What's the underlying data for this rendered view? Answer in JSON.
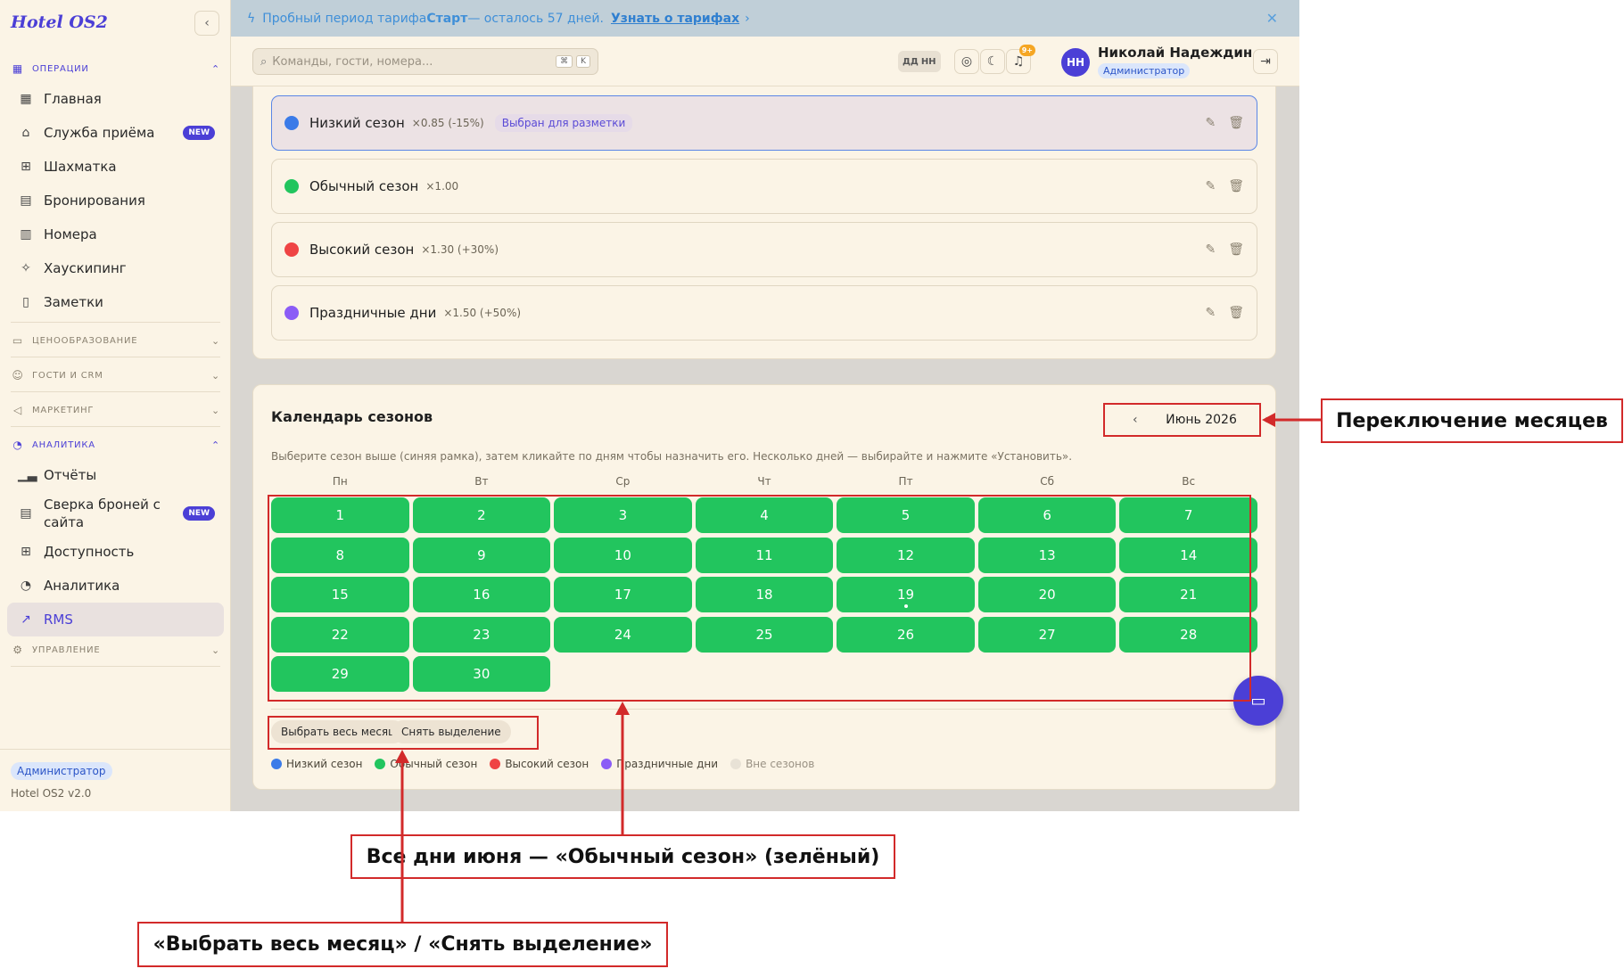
{
  "app": {
    "brand": "Hotel OS2"
  },
  "banner": {
    "text_prefix": "Пробный период тарифа ",
    "plan": "Старт",
    "text_suffix": " — осталось 57 дней.",
    "link": "Узнать о тарифах",
    "arrow": "›",
    "close": "✕"
  },
  "search": {
    "placeholder": "Команды, гости, номера...",
    "key1": "⌘",
    "key2": "K"
  },
  "header": {
    "lang": [
      "ДД",
      "НН"
    ],
    "notif_badge": "9+",
    "avatar": "НН",
    "user_name": "Николай Надеждин",
    "user_role": "Администратор"
  },
  "sidebar": {
    "sections": {
      "operations": "ОПЕРАЦИИ",
      "pricing": "ЦЕНООБРАЗОВАНИЕ",
      "guests": "ГОСТИ И CRM",
      "marketing": "МАРКЕТИНГ",
      "analytics": "АНАЛИТИКА",
      "management": "УПРАВЛЕНИЕ"
    },
    "ops_items": [
      "Главная",
      "Служба приёма",
      "Шахматка",
      "Бронирования",
      "Номера",
      "Хаускипинг",
      "Заметки"
    ],
    "analytics_items": [
      "Отчёты",
      "Сверка броней с сайта",
      "Доступность",
      "Аналитика",
      "RMS"
    ],
    "badge_new": "NEW",
    "footer_role": "Администратор",
    "footer_version": "Hotel OS2 v2.0"
  },
  "seasons": [
    {
      "name": "Низкий сезон",
      "mult": "×0.85 (-15%)",
      "color": "#3b7be8",
      "selected_chip": "Выбран для разметки"
    },
    {
      "name": "Обычный сезон",
      "mult": "×1.00",
      "color": "#22c55e"
    },
    {
      "name": "Высокий сезон",
      "mult": "×1.30 (+30%)",
      "color": "#ef4444"
    },
    {
      "name": "Праздничные дни",
      "mult": "×1.50 (+50%)",
      "color": "#8b5cf6"
    }
  ],
  "calendar": {
    "title": "Календарь сезонов",
    "month": "Июнь 2026",
    "prev": "‹",
    "next": "›",
    "hint": "Выберите сезон выше (синяя рамка), затем кликайте по дням чтобы назначить его. Несколько дней — выбирайте и нажмите «Установить».",
    "weekdays": [
      "Пн",
      "Вт",
      "Ср",
      "Чт",
      "Пт",
      "Сб",
      "Вс"
    ],
    "days": [
      "1",
      "2",
      "3",
      "4",
      "5",
      "6",
      "7",
      "8",
      "9",
      "10",
      "11",
      "12",
      "13",
      "14",
      "15",
      "16",
      "17",
      "18",
      "19",
      "20",
      "21",
      "22",
      "23",
      "24",
      "25",
      "26",
      "27",
      "28",
      "29",
      "30"
    ],
    "today": "19",
    "day_color": "#22c55e",
    "select_month": "Выбрать весь месяц",
    "clear_selection": "Снять выделение",
    "legend": [
      {
        "label": "Низкий сезон",
        "color": "#3b7be8"
      },
      {
        "label": "Обычный сезон",
        "color": "#22c55e"
      },
      {
        "label": "Высокий сезон",
        "color": "#ef4444"
      },
      {
        "label": "Праздничные дни",
        "color": "#8b5cf6"
      },
      {
        "label": "Вне сезонов",
        "color": "#e8e2d6"
      }
    ]
  },
  "annotations": {
    "month_switch": "Переключение месяцев",
    "all_days": "Все дни июня — «Обычный сезон» (зелёный)",
    "buttons": "«Выбрать весь месяц» / «Снять выделение»"
  },
  "colors": {
    "accent": "#4b3fd6",
    "annotation": "#d22a2a"
  }
}
